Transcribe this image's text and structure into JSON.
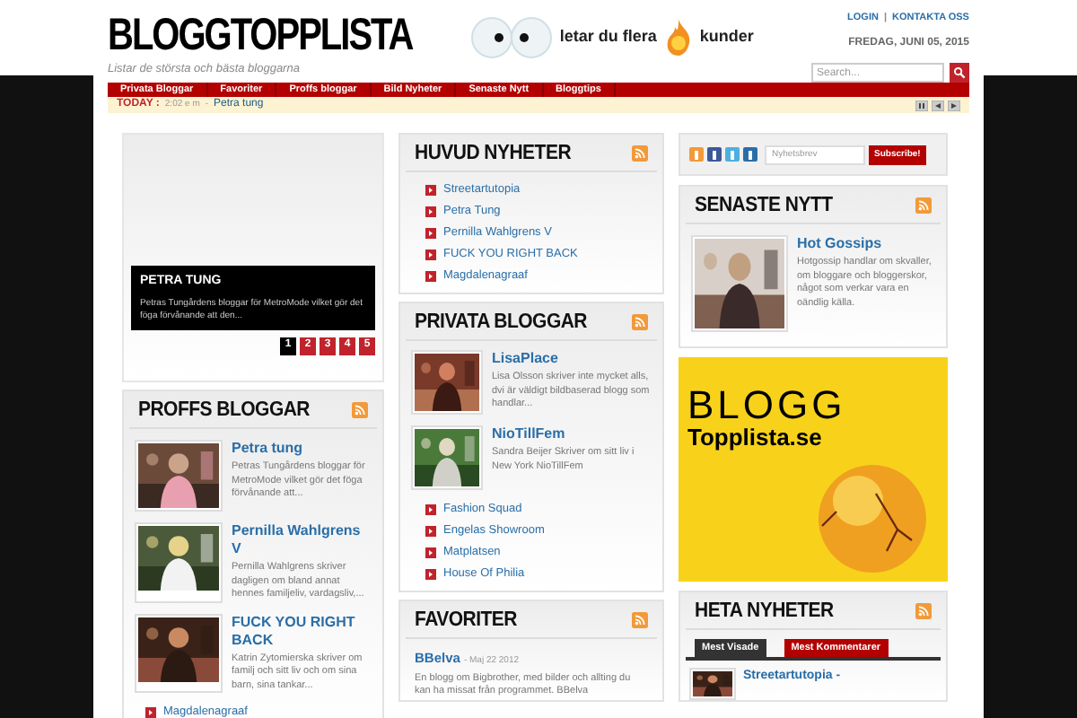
{
  "header": {
    "logo": "BLOGGTOPPLISTA",
    "tagline": "Listar de största och bästa bloggarna",
    "ad": {
      "before": "letar du flera",
      "after": "kunder"
    },
    "top_links": [
      "LOGIN",
      "KONTAKTA OSS"
    ],
    "separator": "|",
    "date": "FREDAG, JUNI 05, 2015",
    "search": {
      "placeholder": "Search..."
    }
  },
  "nav": [
    "Privata Bloggar",
    "Favoriter",
    "Proffs bloggar",
    "Bild Nyheter",
    "Senaste Nytt",
    "Bloggtips"
  ],
  "ticker": {
    "label": "TODAY :",
    "time": "2:02 e m",
    "separator": "-",
    "headline": "Petra tung"
  },
  "slider": {
    "title": "PETRA TUNG",
    "text": "Petras Tungårdens bloggar för MetroMode vilket gör det föga förvånande att den...",
    "pages": [
      {
        "label": "1",
        "selected": true
      },
      {
        "label": "2",
        "selected": false
      },
      {
        "label": "3",
        "selected": false
      },
      {
        "label": "4",
        "selected": false
      },
      {
        "label": "5",
        "selected": false
      }
    ]
  },
  "proffs": {
    "title": "PROFFS BLOGGAR",
    "posts": [
      {
        "title": "Petra tung",
        "excerpt": "Petras Tungårdens bloggar för MetroMode vilket gör det föga förvånande att..."
      },
      {
        "title": "Pernilla Wahlgrens V",
        "excerpt": "Pernilla Wahlgrens skriver dagligen om bland annat hennes familjeliv, vardagsliv,..."
      },
      {
        "title": "FUCK YOU RIGHT BACK",
        "excerpt": "Katrin Zytomierska skriver om familj och sitt liv och om sina barn, sina tankar..."
      }
    ],
    "links": [
      "Magdalenagraaf"
    ]
  },
  "huvud": {
    "title": "HUVUD NYHETER",
    "links": [
      "Streetartutopia",
      "Petra Tung",
      "Pernilla Wahlgrens V",
      "FUCK YOU RIGHT BACK",
      "Magdalenagraaf"
    ]
  },
  "privata": {
    "title": "PRIVATA BLOGGAR",
    "posts": [
      {
        "title": "LisaPlace",
        "excerpt": "Lisa Olsson skriver inte mycket alls, dvi är väldigt bildbaserad blogg som handlar..."
      },
      {
        "title": "NioTillFem",
        "excerpt": "Sandra Beijer Skriver om sitt liv i New York NioTillFem"
      }
    ],
    "links": [
      "Fashion Squad",
      "Engelas Showroom",
      "Matplatsen",
      "House Of Philia"
    ]
  },
  "favoriter": {
    "title": "FAVORITER",
    "posts": [
      {
        "title": "BBelva",
        "date": "- Maj 22 2012",
        "excerpt": "En blogg om Bigbrother, med bilder och allting du kan ha missat från programmet. BBelva"
      }
    ]
  },
  "social": {
    "placeholder": "Nyhetsbrev",
    "button": "Subscribe!"
  },
  "senaste": {
    "title": "SENASTE NYTT",
    "posts": [
      {
        "title": "Hot Gossips",
        "excerpt": "Hotgossip handlar om skvaller, om bloggare och bloggerskor, något som verkar vara en oändlig källa."
      }
    ]
  },
  "banner": {
    "line1": "BLOGG",
    "line2": "Topplista.se"
  },
  "heta": {
    "title": "HETA NYHETER",
    "tabs": [
      {
        "label": "Mest Visade",
        "selected": true
      },
      {
        "label": "Mest Kommentarer",
        "selected": false
      }
    ],
    "posts": [
      {
        "title": "Streetartutopia -"
      }
    ]
  }
}
